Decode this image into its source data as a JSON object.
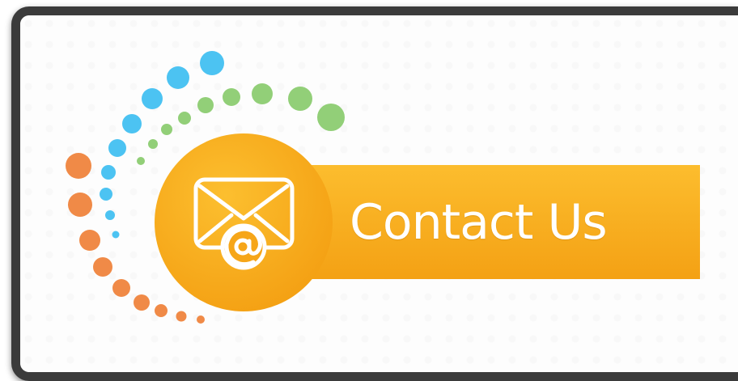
{
  "banner": {
    "label": "Contact Us",
    "icon": "envelope-at-icon",
    "colors": {
      "orange_banner": "#fbb21f",
      "orange_banner_dark": "#f39a12",
      "dots_blue": "#4cc3f2",
      "dots_green": "#92cf78",
      "dots_orange": "#f08a47",
      "frame": "#3b3b3b"
    }
  }
}
